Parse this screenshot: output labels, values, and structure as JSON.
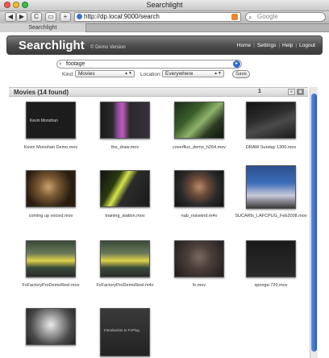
{
  "window": {
    "title": "Searchlight"
  },
  "toolbar": {
    "back": "◀",
    "forward": "▶",
    "reload": "C",
    "add": "+",
    "url": "http://dp.local:9000/search",
    "search_placeholder": "Google"
  },
  "tab": {
    "label": "Searchlight"
  },
  "header": {
    "logo": "Searchlight",
    "subtitle": "© Demo Version",
    "nav": [
      "Home",
      "Settings",
      "Help",
      "Logout"
    ]
  },
  "search": {
    "query": "footage",
    "kind_label": "Kind:",
    "kind_value": "Movies",
    "location_label": "Location:",
    "location_value": "Everywhere",
    "save_label": "Save"
  },
  "results": {
    "title": "Movies (14 found)",
    "page": "1",
    "items": [
      {
        "name": "Kevin Monohan Demo.mov",
        "caption": "Kevin Monohan"
      },
      {
        "name": "the_draw.mov",
        "caption": ""
      },
      {
        "name": "coverflux_demo_h264.mov",
        "caption": ""
      },
      {
        "name": "DRAW Sunday 1300.mov",
        "caption": ""
      },
      {
        "name": "coming up voiced.mov",
        "caption": ""
      },
      {
        "name": "training_station.mov",
        "caption": ""
      },
      {
        "name": "nab_noiseind.m4v",
        "caption": ""
      },
      {
        "name": "SUCARfx_LAFCPUG_Feb2008.mov",
        "caption": ""
      },
      {
        "name": "FxFactoryProDemoReel.mov",
        "caption": ""
      },
      {
        "name": "FxFactoryProDemoReel.m4v",
        "caption": ""
      },
      {
        "name": "fx.mov",
        "caption": ""
      },
      {
        "name": "sponge-720.mov",
        "caption": ""
      },
      {
        "name": "",
        "caption": ""
      },
      {
        "name": "",
        "caption": "Introduction to FxPlug"
      }
    ]
  },
  "icons": {
    "close": "close-icon",
    "minimize": "minimize-icon",
    "zoom": "zoom-icon",
    "search": "search-icon",
    "rss": "rss-icon",
    "grid": "grid-view-icon",
    "list": "list-view-icon"
  }
}
